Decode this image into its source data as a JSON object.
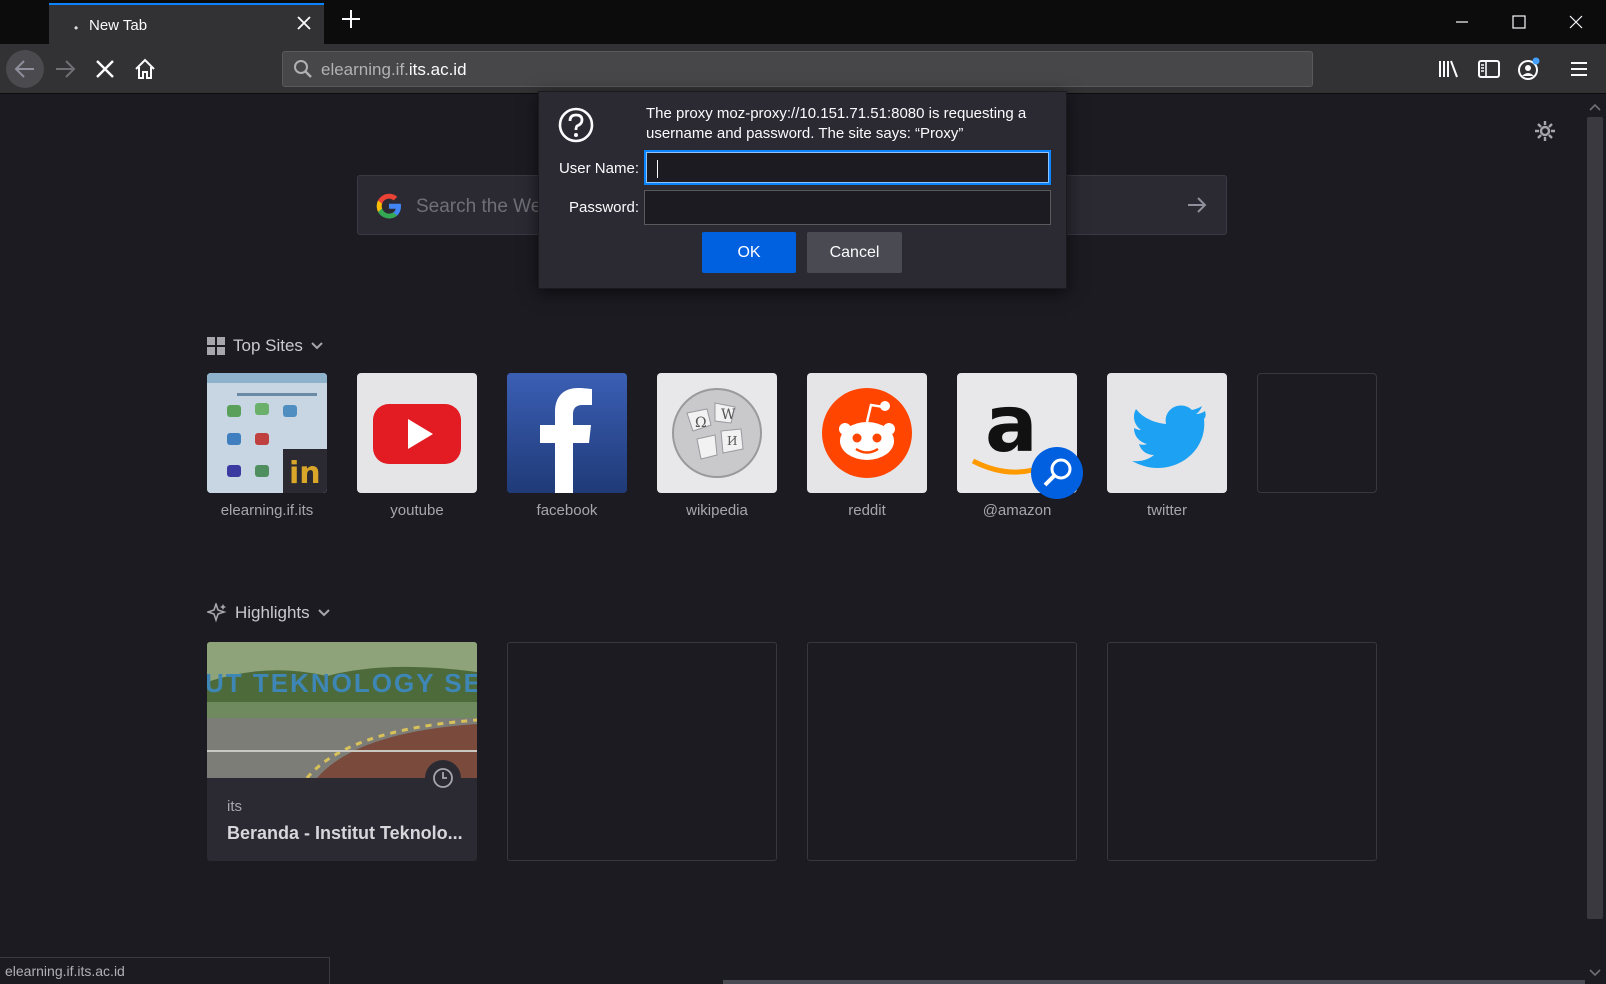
{
  "tab": {
    "title": "New Tab",
    "dot": "•"
  },
  "urlbar": {
    "prefix": "elearning.if.",
    "domain": "its.ac.id"
  },
  "search": {
    "placeholder": "Search the Web"
  },
  "top_sites": {
    "title": "Top Sites",
    "sites": [
      {
        "label": "elearning.if.its"
      },
      {
        "label": "youtube"
      },
      {
        "label": "facebook"
      },
      {
        "label": "wikipedia"
      },
      {
        "label": "reddit"
      },
      {
        "label": "@amazon"
      },
      {
        "label": "twitter"
      }
    ]
  },
  "highlights": {
    "title": "Highlights",
    "card": {
      "host": "its",
      "title": "Beranda - Institut Teknolo...",
      "image_text": "UT TEKNOLOGY SEPULU"
    }
  },
  "dialog": {
    "message": "The proxy moz-proxy://10.151.71.51:8080 is requesting a username and password. The site says: “Proxy”",
    "username_label": "User Name:",
    "password_label": "Password:",
    "username_value": "",
    "password_value": "",
    "ok_label": "OK",
    "cancel_label": "Cancel"
  },
  "status": {
    "text": "elearning.if.its.ac.id"
  },
  "colors": {
    "accent": "#0a84ff",
    "ok_button": "#0061e0",
    "background": "#1c1b22"
  }
}
